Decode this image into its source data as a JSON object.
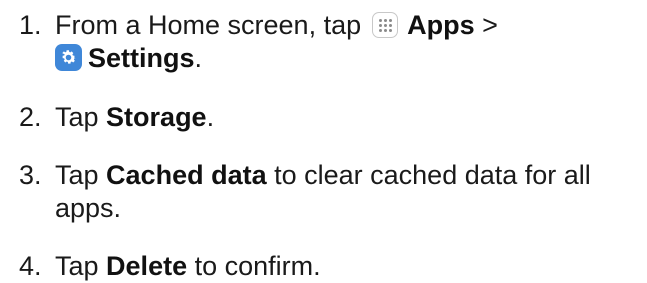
{
  "steps": [
    {
      "number": "1.",
      "line1_pre": "From a Home screen, tap ",
      "apps_icon": "apps-grid-icon",
      "apps_label": "Apps",
      "line1_post": " >",
      "settings_icon": "settings-gear-icon",
      "settings_label": "Settings",
      "line2_post": "."
    },
    {
      "number": "2.",
      "pre": "Tap ",
      "bold": "Storage",
      "post": "."
    },
    {
      "number": "3.",
      "pre": "Tap ",
      "bold": "Cached data",
      "post_line1": " to clear cached data for all",
      "post_line2": "apps."
    },
    {
      "number": "4.",
      "pre": "Tap ",
      "bold": "Delete",
      "post": " to confirm."
    }
  ],
  "colors": {
    "text": "#1a1a1a",
    "settings_icon_bg": "#3f87d8"
  }
}
